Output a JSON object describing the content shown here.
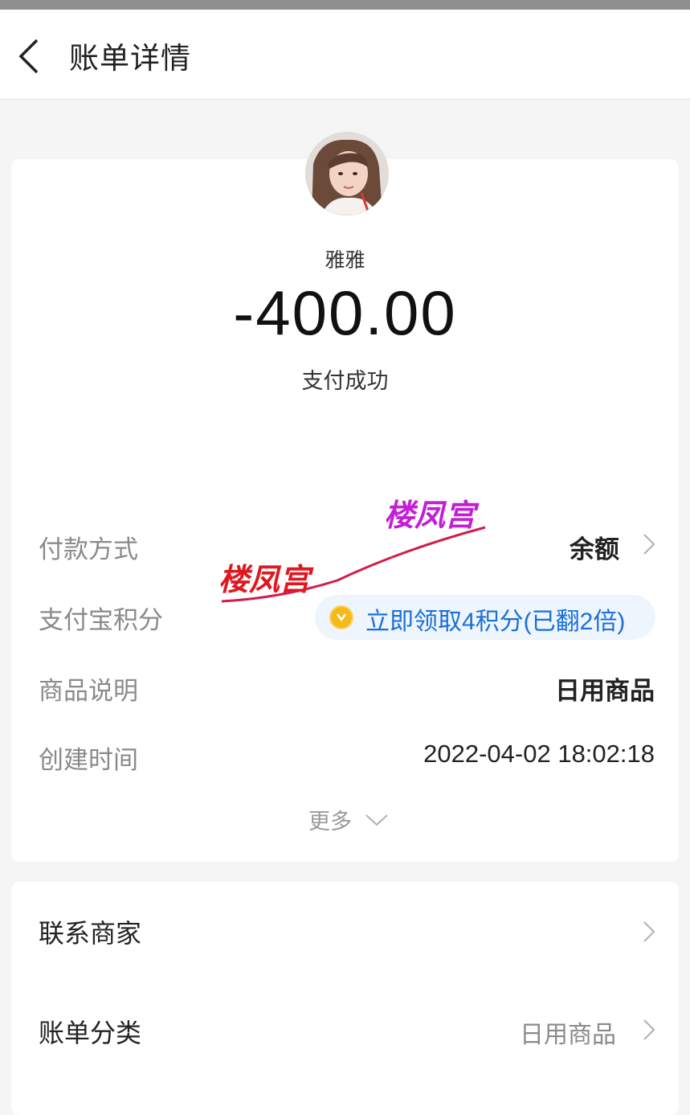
{
  "header": {
    "title": "账单详情"
  },
  "payee": {
    "name": "雅雅",
    "amount": "-400.00",
    "status": "支付成功"
  },
  "details": {
    "payment_method": {
      "label": "付款方式",
      "value": "余额"
    },
    "points": {
      "label": "支付宝积分",
      "value": "立即领取4积分(已翻2倍)"
    },
    "product": {
      "label": "商品说明",
      "value": "日用商品"
    },
    "created": {
      "label": "创建时间",
      "value": "2022-04-02 18:02:18"
    },
    "more": "更多"
  },
  "actions": {
    "contact": {
      "label": "联系商家"
    },
    "category": {
      "label": "账单分类",
      "value": "日用商品"
    }
  },
  "watermark": {
    "text1": "楼凤宫",
    "text2": "楼凤宫"
  },
  "colors": {
    "link_blue": "#1a6fd8",
    "coin": "#f5b91a",
    "label_gray": "#8a8a8a"
  },
  "icons": [
    "back-icon",
    "chevron-right-icon",
    "coin-icon",
    "chevron-down-icon"
  ]
}
